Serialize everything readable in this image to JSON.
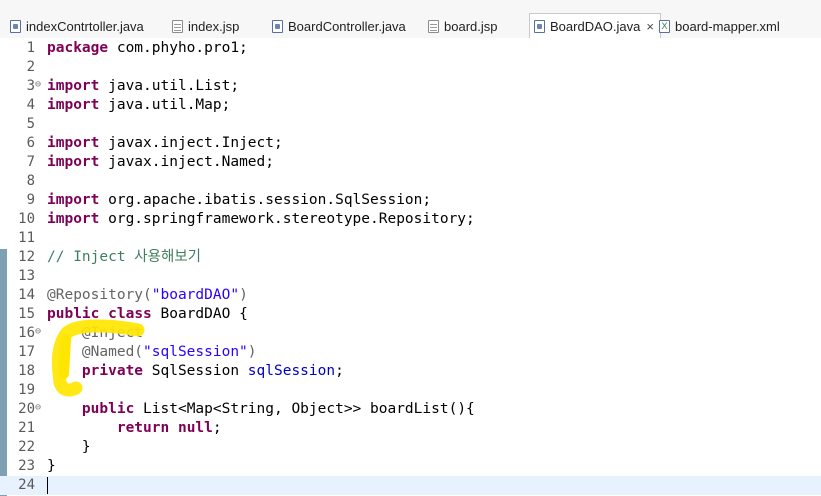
{
  "tabs": [
    {
      "label": "indexContrtoller.java",
      "icon": "java-file-icon"
    },
    {
      "label": "index.jsp",
      "icon": "jsp-file-icon"
    },
    {
      "label": "BoardController.java",
      "icon": "java-file-icon"
    },
    {
      "label": "board.jsp",
      "icon": "jsp-file-icon"
    },
    {
      "label": "BoardDAO.java",
      "icon": "java-file-icon",
      "active": true,
      "close": "×"
    },
    {
      "label": "board-mapper.xml",
      "icon": "xml-file-icon",
      "badge": "X"
    }
  ],
  "lines": [
    {
      "n": "1",
      "parts": [
        {
          "t": "package",
          "c": "kw"
        },
        {
          "t": " com.phyho.pro1;"
        }
      ]
    },
    {
      "n": "2",
      "parts": []
    },
    {
      "n": "3",
      "fold": "⊖",
      "parts": [
        {
          "t": "import",
          "c": "kw"
        },
        {
          "t": " java.util.List;"
        }
      ]
    },
    {
      "n": "4",
      "parts": [
        {
          "t": "import",
          "c": "kw"
        },
        {
          "t": " java.util.Map;"
        }
      ]
    },
    {
      "n": "5",
      "parts": []
    },
    {
      "n": "6",
      "parts": [
        {
          "t": "import",
          "c": "kw"
        },
        {
          "t": " javax.inject.Inject;"
        }
      ]
    },
    {
      "n": "7",
      "parts": [
        {
          "t": "import",
          "c": "kw"
        },
        {
          "t": " javax.inject.Named;"
        }
      ]
    },
    {
      "n": "8",
      "parts": []
    },
    {
      "n": "9",
      "parts": [
        {
          "t": "import",
          "c": "kw"
        },
        {
          "t": " org.apache.ibatis.session.SqlSession;"
        }
      ]
    },
    {
      "n": "10",
      "parts": [
        {
          "t": "import",
          "c": "kw"
        },
        {
          "t": " org.springframework.stereotype.Repository;"
        }
      ]
    },
    {
      "n": "11",
      "parts": []
    },
    {
      "n": "12",
      "parts": [
        {
          "t": "// Inject 사용해보기",
          "c": "cm"
        }
      ]
    },
    {
      "n": "13",
      "parts": []
    },
    {
      "n": "14",
      "parts": [
        {
          "t": "@Repository(",
          "c": "ann"
        },
        {
          "t": "\"boardDAO\"",
          "c": "str"
        },
        {
          "t": ")",
          "c": "ann"
        }
      ]
    },
    {
      "n": "15",
      "parts": [
        {
          "t": "public",
          "c": "kw"
        },
        {
          "t": " "
        },
        {
          "t": "class",
          "c": "kw"
        },
        {
          "t": " BoardDAO {"
        }
      ]
    },
    {
      "n": "16",
      "fold": "⊖",
      "parts": [
        {
          "t": "    "
        },
        {
          "t": "@Inject",
          "c": "ann"
        }
      ]
    },
    {
      "n": "17",
      "parts": [
        {
          "t": "    "
        },
        {
          "t": "@Named(",
          "c": "ann"
        },
        {
          "t": "\"sqlSession\"",
          "c": "str"
        },
        {
          "t": ")",
          "c": "ann"
        }
      ]
    },
    {
      "n": "18",
      "parts": [
        {
          "t": "    "
        },
        {
          "t": "private",
          "c": "kw"
        },
        {
          "t": " SqlSession "
        },
        {
          "t": "sqlSession",
          "c": "fld"
        },
        {
          "t": ";"
        }
      ]
    },
    {
      "n": "19",
      "parts": []
    },
    {
      "n": "20",
      "fold": "⊖",
      "parts": [
        {
          "t": "    "
        },
        {
          "t": "public",
          "c": "kw"
        },
        {
          "t": " List<Map<String, Object>> boardList(){"
        }
      ]
    },
    {
      "n": "21",
      "parts": [
        {
          "t": "        "
        },
        {
          "t": "return",
          "c": "kw"
        },
        {
          "t": " "
        },
        {
          "t": "null",
          "c": "kw"
        },
        {
          "t": ";"
        }
      ]
    },
    {
      "n": "22",
      "parts": [
        {
          "t": "    }"
        }
      ]
    },
    {
      "n": "23",
      "parts": [
        {
          "t": "}"
        }
      ]
    },
    {
      "n": "24",
      "parts": [],
      "current": true
    }
  ],
  "colors": {
    "keyword": "#7f0055",
    "annotation": "#646464",
    "string": "#2a00ff",
    "comment": "#3f7f5f",
    "field": "#0000c0",
    "highlight": "#ffe600"
  }
}
